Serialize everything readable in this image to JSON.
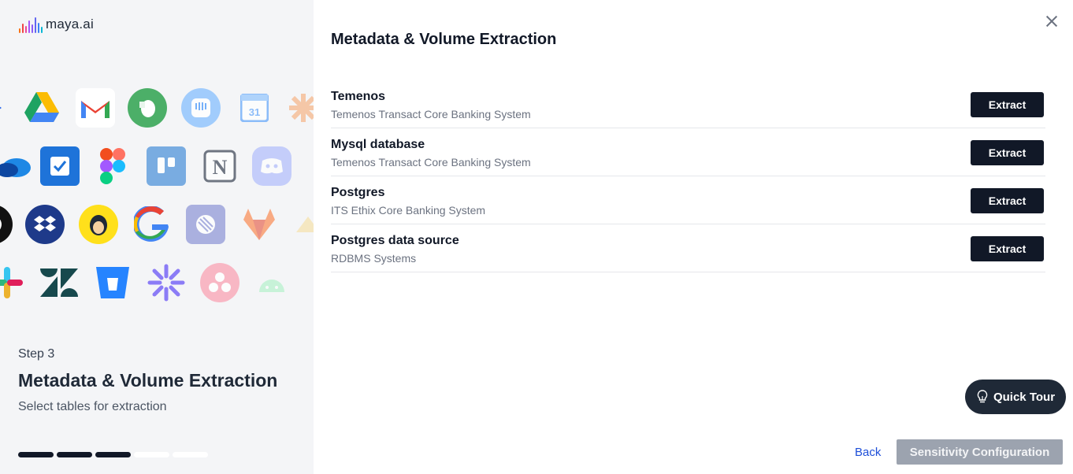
{
  "brand": {
    "name": "maya.ai"
  },
  "left_panel": {
    "step_label": "Step 3",
    "step_title": "Metadata & Volume Extraction",
    "step_subtitle": "Select tables for extraction",
    "progress": {
      "total_steps": 5,
      "completed_steps": 3,
      "active_color": "#111827",
      "inactive_color": "#ffffff"
    },
    "app_icons": [
      "google-drive-icon",
      "gmail-icon",
      "evernote-icon",
      "intercom-icon",
      "google-calendar-icon",
      "zapier-icon",
      "onedrive-icon",
      "task-check-icon",
      "figma-icon",
      "trello-icon",
      "notion-icon",
      "discord-icon",
      "github-icon",
      "dropbox-icon",
      "mailchimp-icon",
      "google-icon",
      "linear-icon",
      "gitlab-icon",
      "slack-icon",
      "zendesk-icon",
      "bitbucket-icon",
      "asterisk-icon",
      "asana-icon",
      "android-icon"
    ]
  },
  "main": {
    "title": "Metadata & Volume Extraction",
    "sources": [
      {
        "name": "Temenos",
        "description": "Temenos Transact Core Banking System",
        "action": "Extract"
      },
      {
        "name": "Mysql database",
        "description": "Temenos Transact Core Banking System",
        "action": "Extract"
      },
      {
        "name": "Postgres",
        "description": "ITS Ethix Core Banking System",
        "action": "Extract"
      },
      {
        "name": "Postgres data source",
        "description": "RDBMS Systems",
        "action": "Extract"
      }
    ]
  },
  "quick_tour": {
    "label": "Quick Tour"
  },
  "footer": {
    "back_label": "Back",
    "next_label": "Sensitivity Configuration"
  }
}
